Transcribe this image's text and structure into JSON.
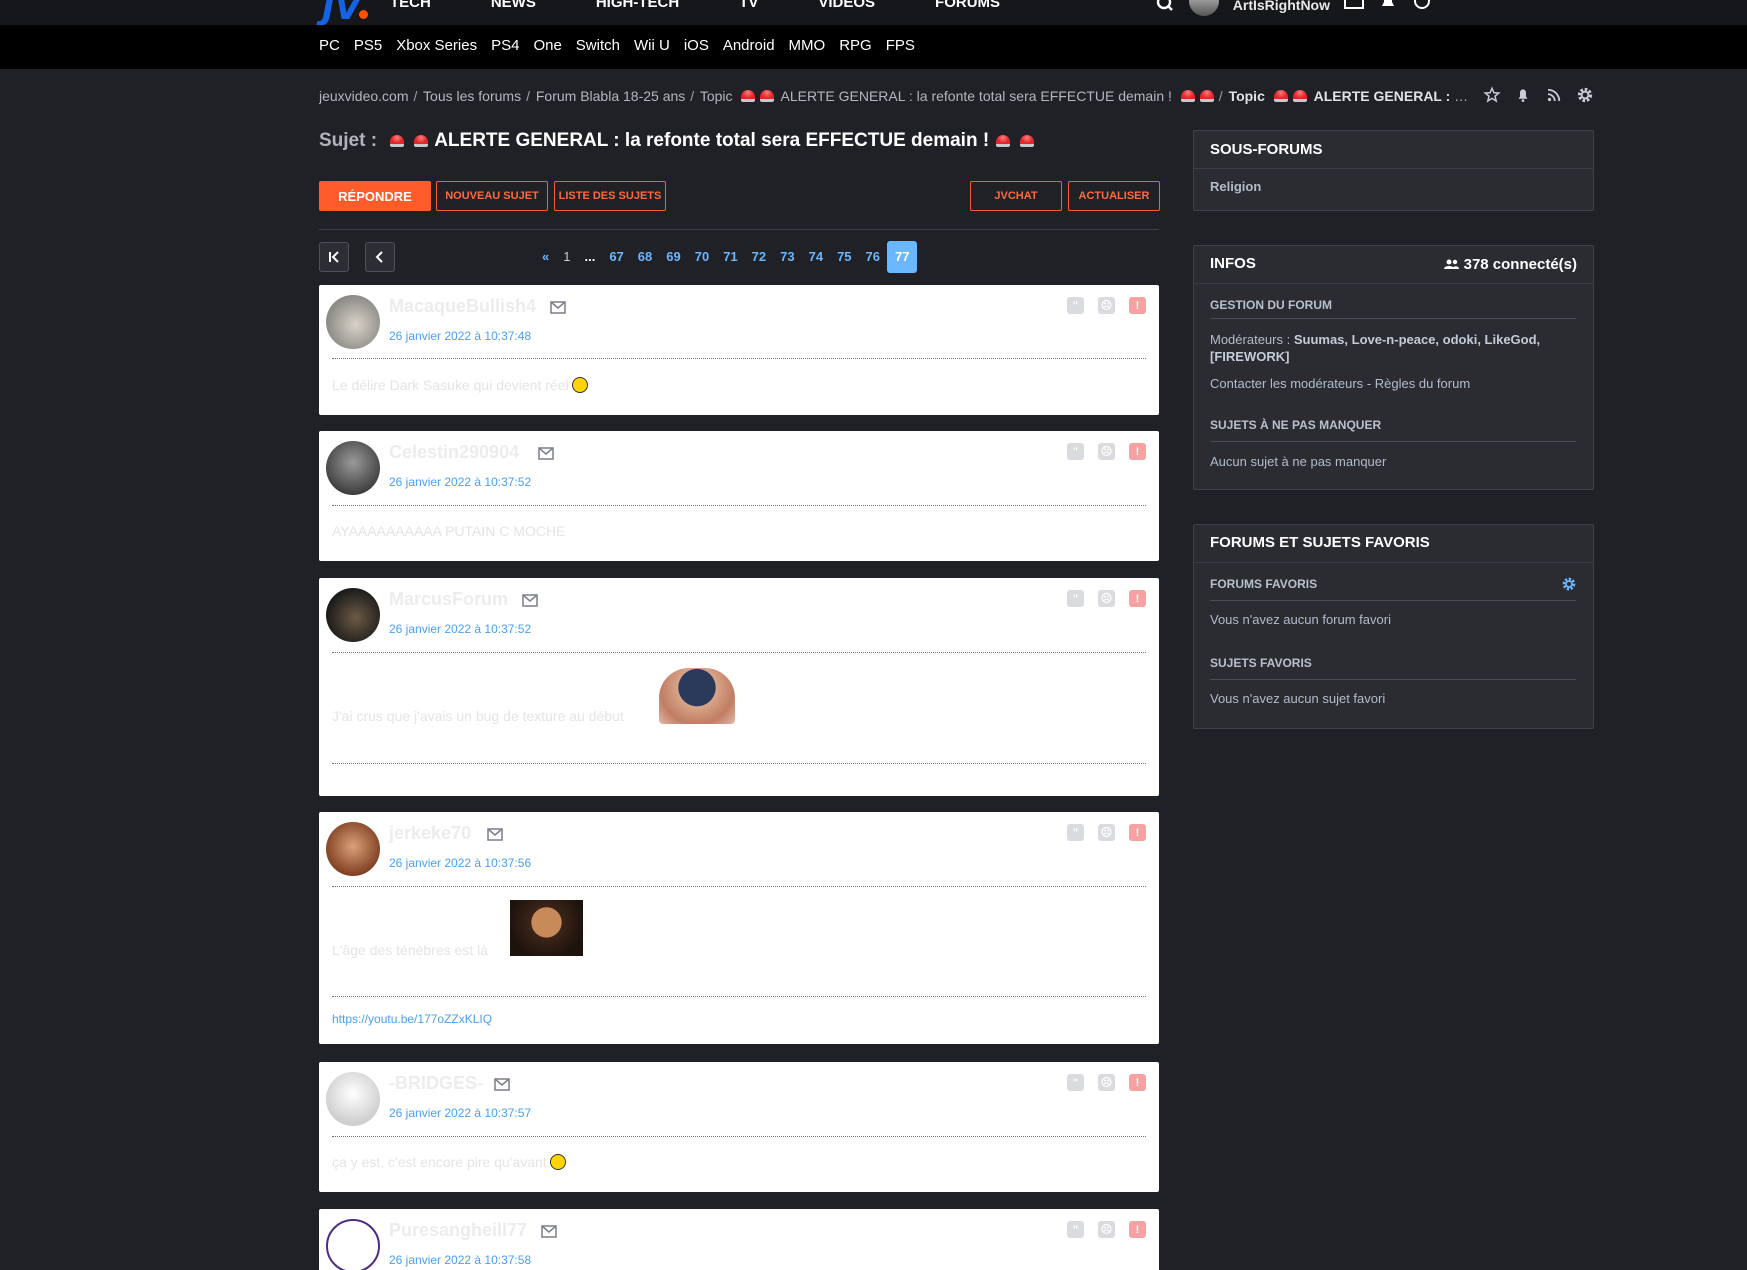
{
  "header": {
    "logo": "JV",
    "nav": [
      "TECH",
      "NEWS",
      "HIGH-TECH",
      "TV",
      "VIDEOS",
      "FORUMS"
    ],
    "username": "ArtIsRightNow"
  },
  "platforms": [
    "PC",
    "PS5",
    "Xbox Series",
    "PS4",
    "One",
    "Switch",
    "Wii U",
    "iOS",
    "Android",
    "MMO",
    "RPG",
    "FPS"
  ],
  "breadcrumb": {
    "items": [
      "jeuxvideo.com",
      "Tous les forums",
      "Forum Blabla 18-25 ans",
      "Topic"
    ],
    "topic_text": "ALERTE GENERAL : la refonte total sera EFFECTUE demain !",
    "topic_bold_prefix": "Topic",
    "topic_bold_text": "ALERTE GENERAL : la ..."
  },
  "topic": {
    "prefix": "Sujet :",
    "title": "ALERTE GENERAL : la refonte total sera EFFECTUE demain !"
  },
  "buttons": {
    "reply": "RÉPONDRE",
    "new_topic": "NOUVEAU SUJET",
    "topic_list": "LISTE DES SUJETS",
    "jvchat": "JVCHAT",
    "refresh": "ACTUALISER"
  },
  "pagination": {
    "prev_all": "«",
    "first": "1",
    "ellipsis": "...",
    "pages": [
      "67",
      "68",
      "69",
      "70",
      "71",
      "72",
      "73",
      "74",
      "75",
      "76"
    ],
    "current": "77"
  },
  "posts": [
    {
      "author": "MacaqueBullish4",
      "date": "26 janvier 2022 à 10:37:48",
      "body": "Le délire Dark Sasuke qui devient réel"
    },
    {
      "author": "Celestin290904",
      "date": "26 janvier 2022 à 10:37:52",
      "body": "AYAAAAAAAAAA PUTAIN C MOCHE"
    },
    {
      "author": "MarcusForum",
      "date": "26 janvier 2022 à 10:37:52",
      "body": "J'ai crus que j'avais un bug de texture au début"
    },
    {
      "author": "jerkeke70",
      "date": "26 janvier 2022 à 10:37:56",
      "body": "L'âge des ténèbres est là",
      "link": "https://youtu.be/177oZZxKLIQ"
    },
    {
      "author": "-BRIDGES-",
      "date": "26 janvier 2022 à 10:37:57",
      "body": "ça y est, c'est encore pire qu'avant"
    },
    {
      "author": "Puresangheill77",
      "date": "26 janvier 2022 à 10:37:58",
      "body": ""
    }
  ],
  "sidebar": {
    "subforums": {
      "title": "SOUS-FORUMS",
      "items": [
        "Religion"
      ]
    },
    "infos": {
      "title": "INFOS",
      "connected": "378 connecté(s)",
      "management_title": "GESTION DU FORUM",
      "moderators_label": "Modérateurs :",
      "moderators": "Suumas, Love-n-peace, odoki, LikeGod,",
      "moderators_2": "[FIREWORK]",
      "contact": "Contacter les modérateurs",
      "rules_sep": "-",
      "rules": "Règles du forum",
      "must_see_title": "SUJETS À NE PAS MANQUER",
      "must_see_empty": "Aucun sujet à ne pas manquer"
    },
    "favorites": {
      "title": "FORUMS ET SUJETS FAVORIS",
      "forums_title": "FORUMS FAVORIS",
      "forums_empty": "Vous n'avez aucun forum favori",
      "topics_title": "SUJETS FAVORIS",
      "topics_empty": "Vous n'avez aucun sujet favori"
    }
  },
  "colors": {
    "accent": "#ff5c29",
    "link": "#4aa0f0",
    "page_current": "#6ab6ff",
    "background": "#1f2126"
  }
}
